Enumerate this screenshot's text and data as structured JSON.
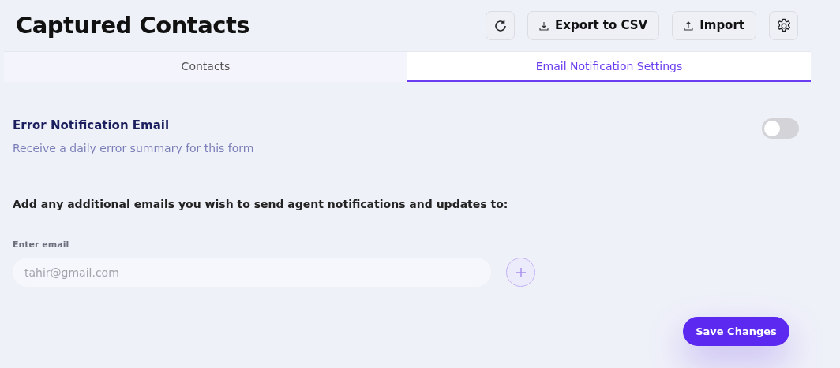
{
  "header": {
    "title": "Captured Contacts",
    "actions": [
      {
        "kind": "refresh"
      },
      {
        "kind": "export",
        "label": "Export to CSV"
      },
      {
        "kind": "import",
        "label": "Import"
      },
      {
        "kind": "settings"
      }
    ]
  },
  "tabs": [
    {
      "label": "Contacts",
      "selected": false
    },
    {
      "label": "Email Notification Settings",
      "selected": true
    }
  ],
  "error_notification": {
    "title": "Error Notification Email",
    "description": "Receive a daily error summary for this form",
    "on": false
  },
  "additional_emails": {
    "prompt": "Add any additional emails you wish to send agent notifications and updates to:",
    "field_label": "Enter email",
    "placeholder": "tahir@gmail.com"
  },
  "save_button": "Save Changes"
}
